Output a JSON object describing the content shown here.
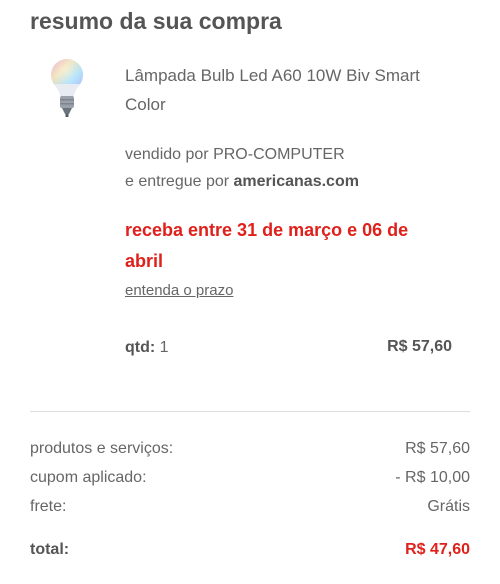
{
  "section_title": "resumo da sua compra",
  "product": {
    "name": "Lâmpada Bulb Led A60 10W Biv Smart Color",
    "image_icon": "led-bulb-icon",
    "sold_by_prefix": "vendido por ",
    "seller": "PRO-COMPUTER",
    "delivered_by_prefix": "e entregue por ",
    "delivered_by": "americanas.com",
    "delivery_estimate": "receba entre 31 de março e 06 de abril",
    "deadline_link": "entenda o prazo",
    "qty_label": "qtd:",
    "qty_value": "1",
    "price": "R$ 57,60"
  },
  "summary": {
    "products_label": "produtos e serviços:",
    "products_value": "R$ 57,60",
    "coupon_label": "cupom aplicado:",
    "coupon_value": "- R$ 10,00",
    "shipping_label": "frete:",
    "shipping_value": "Grátis",
    "total_label": "total:",
    "total_value": "R$ 47,60"
  },
  "colors": {
    "accent_red": "#e0201b",
    "text_gray": "#555555",
    "divider": "#dddddd"
  }
}
